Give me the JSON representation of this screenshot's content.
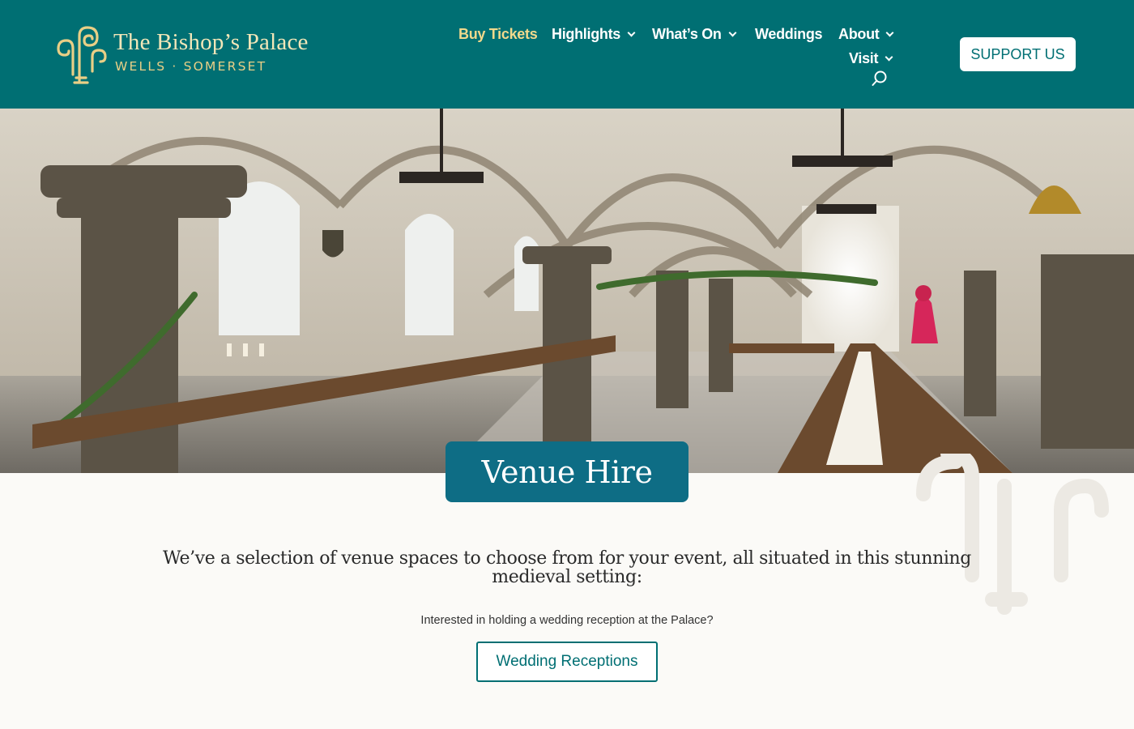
{
  "brand": {
    "name": "The Bishop’s Palace",
    "location": "WELLS · SOMERSET",
    "colors": {
      "header": "#006f73",
      "accent": "#f2d98c",
      "title_box": "#0e6d85"
    }
  },
  "nav": {
    "buy_tickets": "Buy Tickets",
    "highlights": "Highlights",
    "whats_on": "What’s On",
    "weddings": "Weddings",
    "about": "About",
    "visit": "Visit",
    "search_icon": "search-icon"
  },
  "header": {
    "support_label": "SUPPORT US"
  },
  "hero": {
    "title": "Venue Hire",
    "image": "vaulted-undercroft-banquet-photo"
  },
  "content": {
    "intro": "We’ve a selection of venue spaces to choose from for your event, all situated in this stunning medieval setting:",
    "question": "Interested in holding a wedding reception at the Palace?",
    "wedding_button": "Wedding Receptions"
  }
}
